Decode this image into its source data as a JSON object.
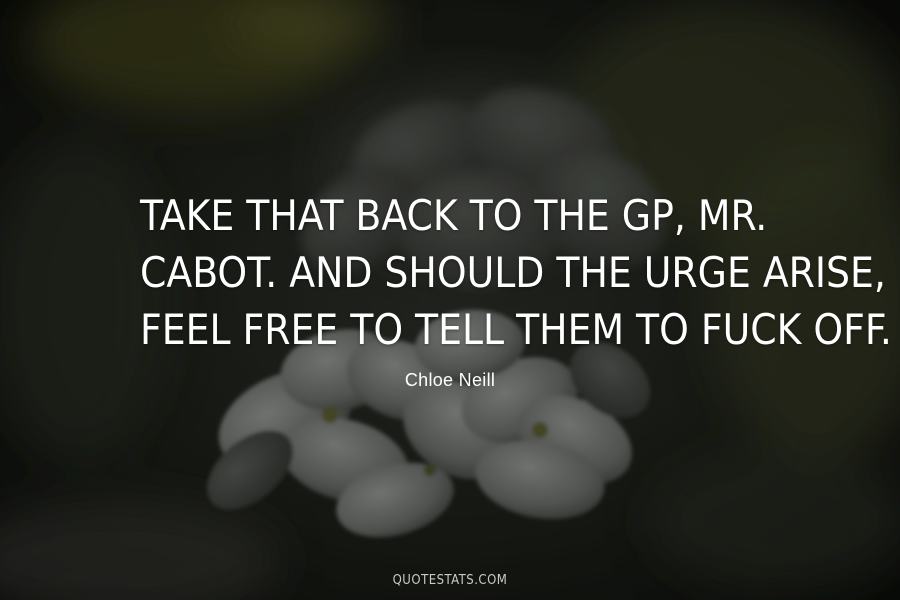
{
  "quote": {
    "lines": [
      "TAKE THAT BACK TO THE GP, MR.",
      "CABOT. AND SHOULD THE URGE ARISE,",
      "FEEL FREE TO TELL THEM TO FUCK OFF."
    ]
  },
  "author": "Chloe Neill",
  "watermark": "QUOTESTATS.COM",
  "colors": {
    "text": "#ffffff",
    "background": "#1e211b",
    "watermark": "#c9cbc6"
  }
}
